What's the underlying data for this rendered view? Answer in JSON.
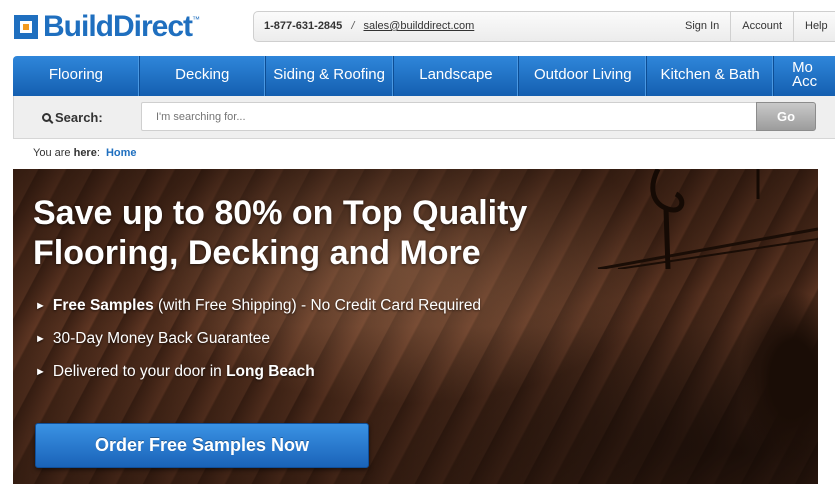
{
  "header": {
    "logo": {
      "text": "BuildDirect",
      "tm": "™"
    },
    "contact": {
      "phone": "1-877-631-2845",
      "separator": "/",
      "email": "sales@builddirect.com"
    },
    "links": [
      {
        "label": "Sign In"
      },
      {
        "label": "Account"
      },
      {
        "label": "Help"
      }
    ]
  },
  "nav": {
    "items": [
      {
        "label": "Flooring"
      },
      {
        "label": "Decking"
      },
      {
        "label": "Siding & Roofing"
      },
      {
        "label": "Landscape"
      },
      {
        "label": "Outdoor Living"
      },
      {
        "label": "Kitchen & Bath"
      }
    ],
    "more_line1": "Mo",
    "more_line2": "Acc"
  },
  "search": {
    "label": "Search:",
    "placeholder": "I'm searching for...",
    "button": "Go"
  },
  "breadcrumb": {
    "prefix": "You are",
    "here": "here",
    "colon": ":",
    "home": "Home"
  },
  "hero": {
    "title_line1": "Save up to 80% on Top Quality",
    "title_line2": "Flooring, Decking and More",
    "bullets": [
      {
        "bold": "Free Samples",
        "text": " (with Free Shipping) - No Credit Card Required"
      },
      {
        "bold": "",
        "text": "30-Day Money Back Guarantee"
      },
      {
        "prefix": "Delivered to your door in ",
        "bold": "Long Beach"
      }
    ],
    "cta": "Order Free Samples Now"
  },
  "colors": {
    "brand_blue": "#1f6fbf",
    "nav_blue": "#1d6fc4",
    "accent_orange": "#f39a1d"
  }
}
